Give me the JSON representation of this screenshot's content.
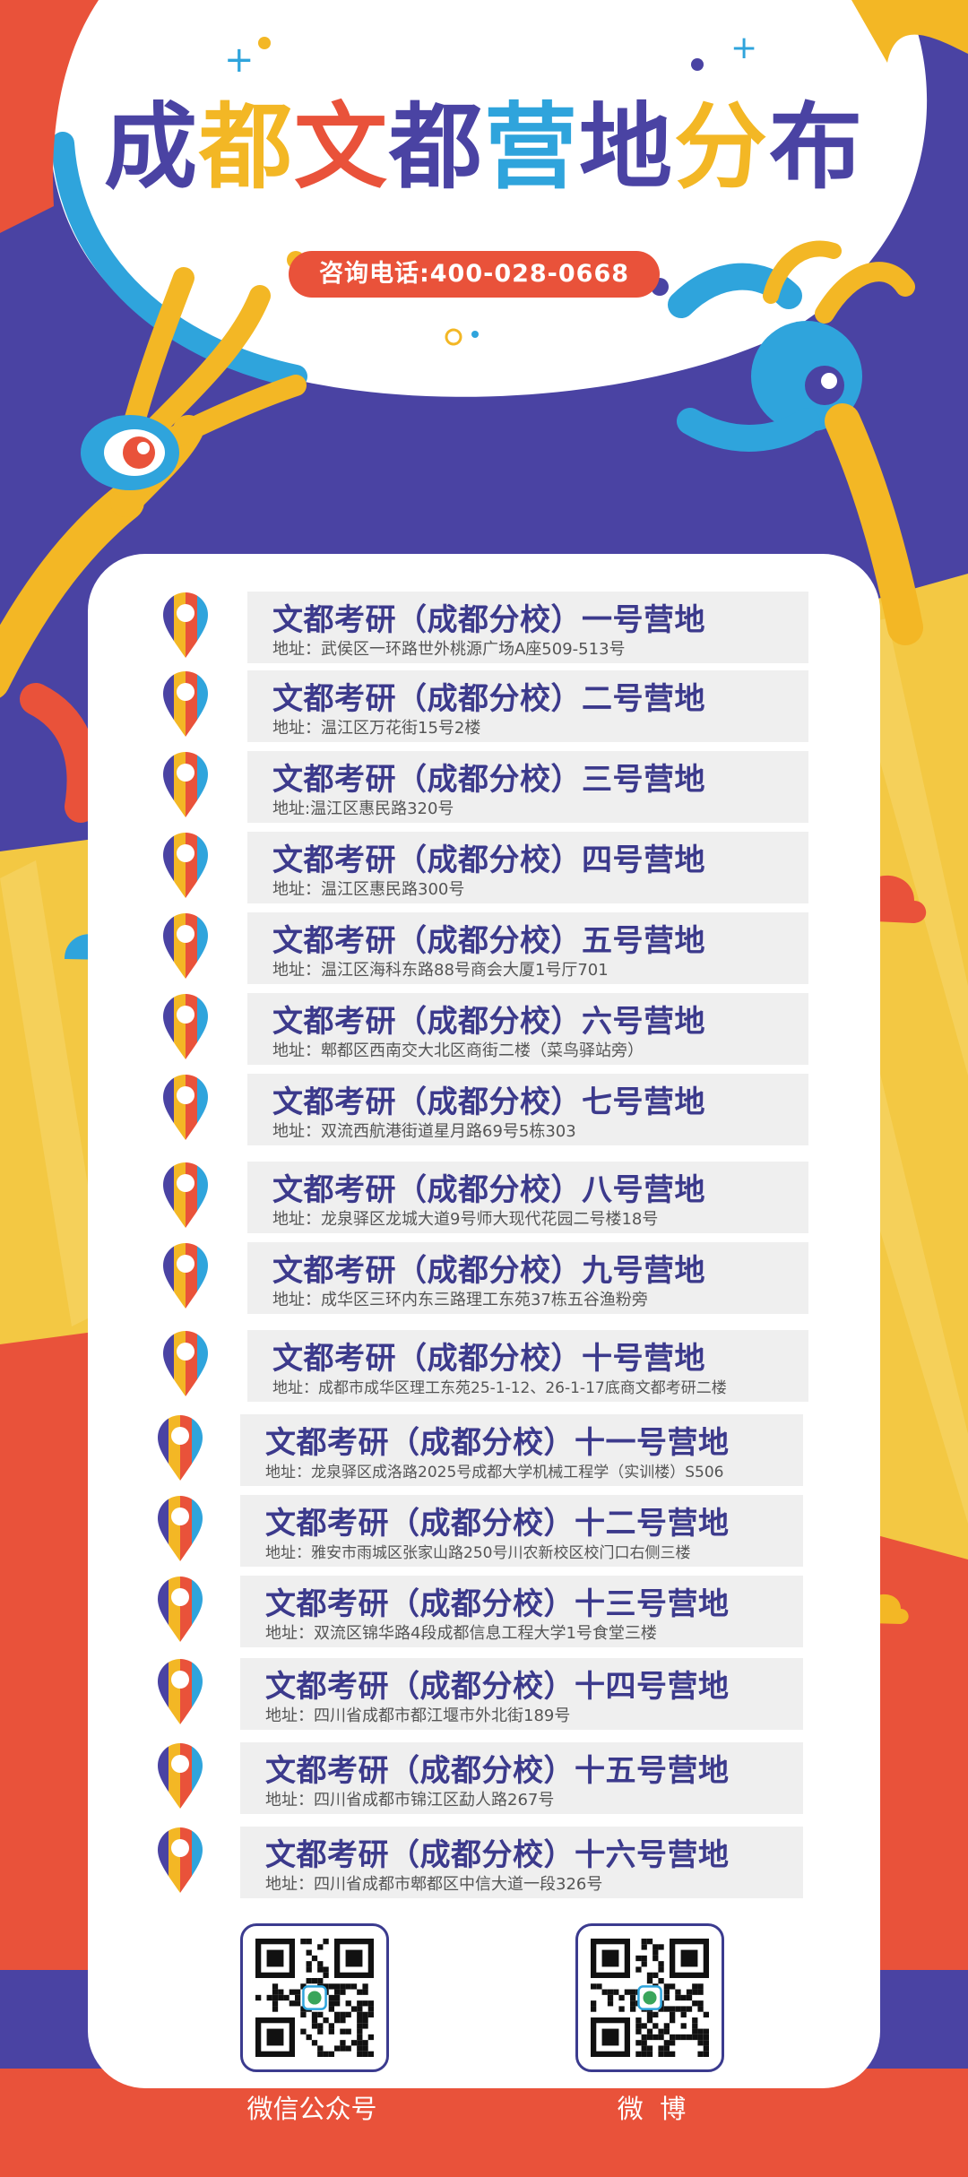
{
  "title": {
    "chars": [
      {
        "text": "成",
        "color": "#4a43a3"
      },
      {
        "text": "都",
        "color": "#f3b725"
      },
      {
        "text": "文",
        "color": "#e9523a"
      },
      {
        "text": "都",
        "color": "#4a43a3"
      },
      {
        "text": "营",
        "color": "#2fa4dc"
      },
      {
        "text": "地",
        "color": "#4a43a3"
      },
      {
        "text": "分",
        "color": "#f3b725"
      },
      {
        "text": "布",
        "color": "#4a43a3"
      }
    ]
  },
  "phone": "咨询电话:400-028-0668",
  "campuses": [
    {
      "name": "文都考研（成都分校）一号营地",
      "address": "地址：武侯区一环路世外桃源广场A座509-513号"
    },
    {
      "name": "文都考研（成都分校）二号营地",
      "address": "地址：温江区万花街15号2楼"
    },
    {
      "name": "文都考研（成都分校）三号营地",
      "address": "地址:温江区惠民路320号"
    },
    {
      "name": "文都考研（成都分校）四号营地",
      "address": "地址：温江区惠民路300号"
    },
    {
      "name": "文都考研（成都分校）五号营地",
      "address": "地址：温江区海科东路88号商会大厦1号厅701"
    },
    {
      "name": "文都考研（成都分校）六号营地",
      "address": "地址：郫都区西南交大北区商街二楼（菜鸟驿站旁）"
    },
    {
      "name": "文都考研（成都分校）七号营地",
      "address": "地址：双流西航港街道星月路69号5栋303"
    },
    {
      "name": "文都考研（成都分校）八号营地",
      "address": "地址：龙泉驿区龙城大道9号师大现代花园二号楼18号"
    },
    {
      "name": "文都考研（成都分校）九号营地",
      "address": "地址：成华区三环内东三路理工东苑37栋五谷渔粉旁"
    },
    {
      "name": "文都考研（成都分校）十号营地",
      "address": "地址：成都市成华区理工东苑25-1-12、26-1-17底商文都考研二楼"
    },
    {
      "name": "文都考研（成都分校）十一号营地",
      "address": "地址：龙泉驿区成洛路2025号成都大学机械工程学（实训楼）S506"
    },
    {
      "name": "文都考研（成都分校）十二号营地",
      "address": "地址：雅安市雨城区张家山路250号川农新校区校门口右侧三楼"
    },
    {
      "name": "文都考研（成都分校）十三号营地",
      "address": "地址：双流区锦华路4段成都信息工程大学1号食堂三楼"
    },
    {
      "name": "文都考研（成都分校）十四号营地",
      "address": "地址：四川省成都市都江堰市外北街189号"
    },
    {
      "name": "文都考研（成都分校）十五号营地",
      "address": "地址：四川省成都市锦江区勐人路267号"
    },
    {
      "name": "文都考研（成都分校）十六号营地",
      "address": "地址：四川省成都市郫都区中信大道一段326号"
    }
  ],
  "qr_codes": [
    {
      "label": "微信公众号",
      "icon": "qr-code-icon"
    },
    {
      "label": "微  博",
      "icon": "qr-code-icon"
    }
  ],
  "colors": {
    "purple": "#4a43a3",
    "yellow": "#f3b725",
    "red": "#e9523a",
    "blue": "#2fa4dc"
  }
}
